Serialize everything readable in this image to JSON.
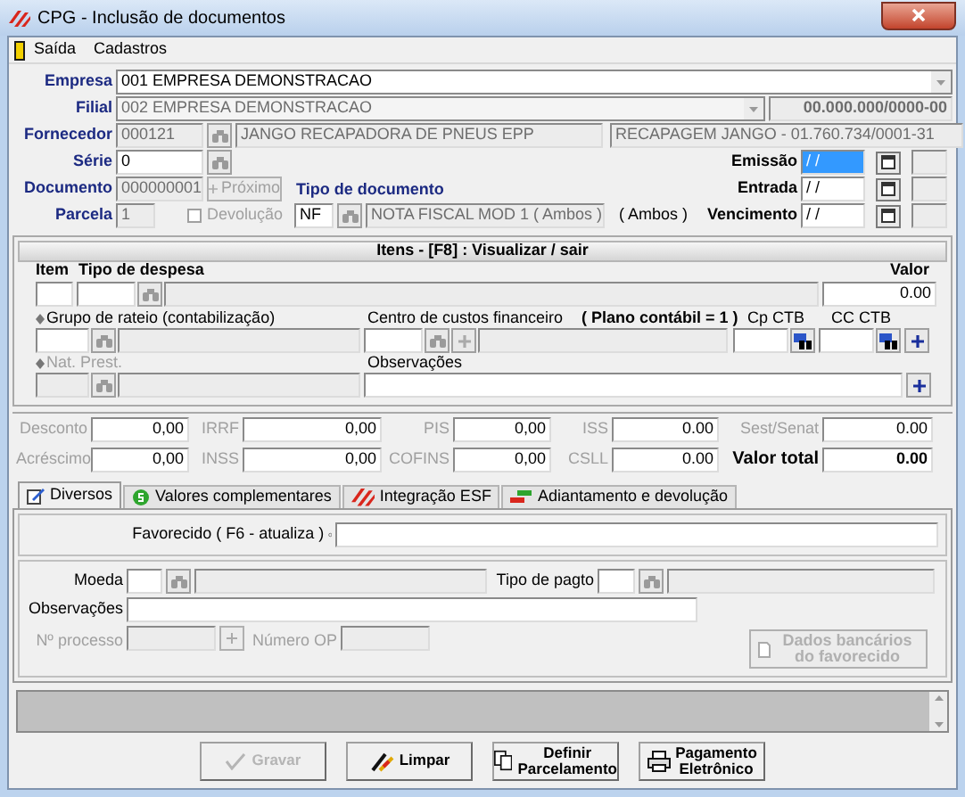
{
  "window": {
    "title": "CPG - Inclusão de documentos"
  },
  "menu": [
    "Saída",
    "Cadastros"
  ],
  "header": {
    "empresa": {
      "label": "Empresa",
      "value": "001 EMPRESA DEMONSTRACAO"
    },
    "filial": {
      "label": "Filial",
      "value": "002 EMPRESA DEMONSTRACAO",
      "cnpj": "00.000.000/0000-00",
      "disabled": true
    },
    "fornecedor": {
      "label": "Fornecedor",
      "code": "000121",
      "name": "JANGO RECAPADORA DE PNEUS EPP",
      "extra": "RECAPAGEM JANGO  - 01.760.734/0001-31"
    },
    "serie": {
      "label": "Série",
      "value": "0"
    },
    "documento": {
      "label": "Documento",
      "value": "000000001",
      "next_button": {
        "label": "Próximo",
        "disabled": true
      }
    },
    "parcela": {
      "label": "Parcela",
      "value": "1"
    },
    "devolucao": {
      "label": "Devolução",
      "checked": false,
      "disabled": true
    },
    "tipo_documento": {
      "label": "Tipo de documento",
      "code": "NF",
      "name": "NOTA FISCAL MOD 1 ( Ambos )",
      "note": "( Ambos )"
    },
    "dates": [
      {
        "label": "Emissão",
        "value": "/ /",
        "focused": true
      },
      {
        "label": "Entrada",
        "value": "/ /",
        "focused": false
      },
      {
        "label": "Vencimento",
        "value": "/ /",
        "focused": false
      }
    ]
  },
  "items": {
    "title": "Itens  - [F8] : Visualizar / sair",
    "item_label": "Item",
    "tipo_label": "Tipo de despesa",
    "valor_label": "Valor",
    "valor": "0.00",
    "grupo_label": "Grupo de rateio (contabilização)",
    "centro_label": "Centro de custos financeiro",
    "plano": "( Plano contábil = 1 )",
    "cp_label": "Cp CTB",
    "cc_label": "CC CTB",
    "nat_label": "Nat. Prest.",
    "obs_label": "Observações"
  },
  "taxes": [
    {
      "label": "Desconto",
      "value": "0,00"
    },
    {
      "label": "IRRF",
      "value": "0,00"
    },
    {
      "label": "PIS",
      "value": "0,00"
    },
    {
      "label": "ISS",
      "value": "0.00"
    },
    {
      "label": "Sest/Senat",
      "value": "0.00"
    },
    {
      "label": "Acréscimo",
      "value": "0,00"
    },
    {
      "label": "INSS",
      "value": "0,00"
    },
    {
      "label": "COFINS",
      "value": "0,00"
    },
    {
      "label": "CSLL",
      "value": "0.00"
    }
  ],
  "valor_total": {
    "label": "Valor total",
    "value": "0.00"
  },
  "tabs": [
    {
      "label": "Diversos",
      "selected": true,
      "kind": "pencil"
    },
    {
      "label": "Valores complementares",
      "selected": false,
      "kind": "money"
    },
    {
      "label": "Integração ESF",
      "selected": false,
      "kind": "stripes"
    },
    {
      "label": "Adiantamento e devolução",
      "selected": false,
      "kind": "arrows"
    }
  ],
  "tab_panel": {
    "favorecido_label": "Favorecido ( F6 - atualiza )",
    "moeda_label": "Moeda",
    "tipo_pagto_label": "Tipo de pagto",
    "obs_label": "Observações",
    "processo_label": "Nº processo",
    "op_label": "Número OP",
    "bank_button": {
      "label": "Dados bancários do favorecido",
      "disabled": true
    }
  },
  "buttons": [
    {
      "label": "Gravar",
      "disabled": true,
      "kind": "check"
    },
    {
      "label": "Limpar",
      "disabled": false,
      "kind": "eraser"
    },
    {
      "label": "Definir Parcelamento",
      "disabled": false,
      "kind": "pages"
    },
    {
      "label": "Pagamento Eletrônico",
      "disabled": false,
      "kind": "printer"
    }
  ]
}
